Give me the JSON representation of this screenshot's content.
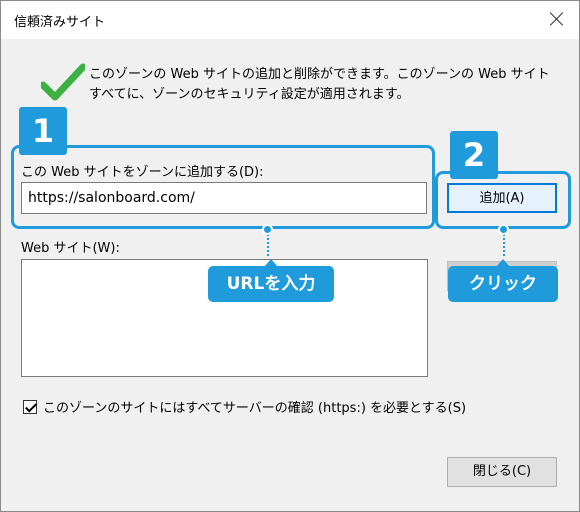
{
  "window": {
    "title": "信頼済みサイト",
    "close_icon": "close-icon"
  },
  "header": {
    "icon": "checkmark-icon",
    "description": "このゾーンの Web サイトの追加と削除ができます。このゾーンの Web サイトすべてに、ゾーンのセキュリティ設定が適用されます。"
  },
  "add_section": {
    "label": "この Web サイトをゾーンに追加する(D):",
    "input_value": "https://salonboard.com/",
    "add_button": "追加(A)"
  },
  "websites": {
    "label": "Web サイト(W):",
    "items": []
  },
  "https_option": {
    "checked": true,
    "label": "このゾーンのサイトにはすべてサーバーの確認 (https:) を必要とする(S)"
  },
  "footer": {
    "close_button": "閉じる(C)"
  },
  "annotations": {
    "step1": "1",
    "step2": "2",
    "callout_left": "URLを入力",
    "callout_right": "クリック",
    "accent_color": "#1f9bdc"
  }
}
